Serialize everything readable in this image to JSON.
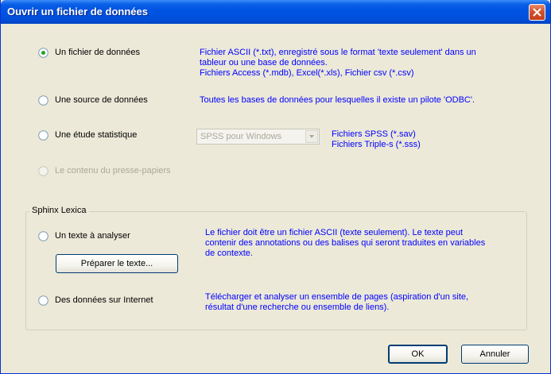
{
  "dialog": {
    "title": "Ouvrir un fichier de données"
  },
  "options": [
    {
      "label": "Un fichier de données",
      "selected": true,
      "enabled": true,
      "description": [
        "Fichier ASCII (*.txt), enregistré sous le format 'texte seulement' dans un",
        "tableur ou une base de données.",
        "Fichiers Access (*.mdb), Excel(*.xls), Fichier csv (*.csv)"
      ]
    },
    {
      "label": "Une source de données",
      "selected": false,
      "enabled": true,
      "description": [
        "Toutes les bases de données pour lesquelles il existe un pilote 'ODBC'."
      ]
    },
    {
      "label": "Une étude statistique",
      "selected": false,
      "enabled": true,
      "description": [
        "Fichiers SPSS (*.sav)",
        "Fichiers Triple-s (*.sss)"
      ]
    },
    {
      "label": "Le contenu du presse-papiers",
      "selected": false,
      "enabled": false
    }
  ],
  "combo": {
    "value": "SPSS pour Windows",
    "enabled": false
  },
  "lexica": {
    "title": "Sphinx Lexica",
    "options": [
      {
        "label": "Un texte à analyser",
        "selected": false,
        "description": [
          "Le fichier doit être un fichier ASCII (texte seulement). Le texte peut",
          "contenir des annotations ou des balises qui seront traduites en variables",
          "de contexte."
        ]
      },
      {
        "label": "Des données sur Internet",
        "selected": false,
        "description": [
          "Télécharger et analyser un ensemble de pages (aspiration d'un site,",
          "résultat d'une recherche ou ensemble de liens)."
        ]
      }
    ],
    "prepare_button": "Préparer le texte..."
  },
  "buttons": {
    "ok": "OK",
    "cancel": "Annuler"
  },
  "colors": {
    "description_text": "#0000ff",
    "titlebar": "#0054e3",
    "dialog_bg": "#ece9d8"
  }
}
